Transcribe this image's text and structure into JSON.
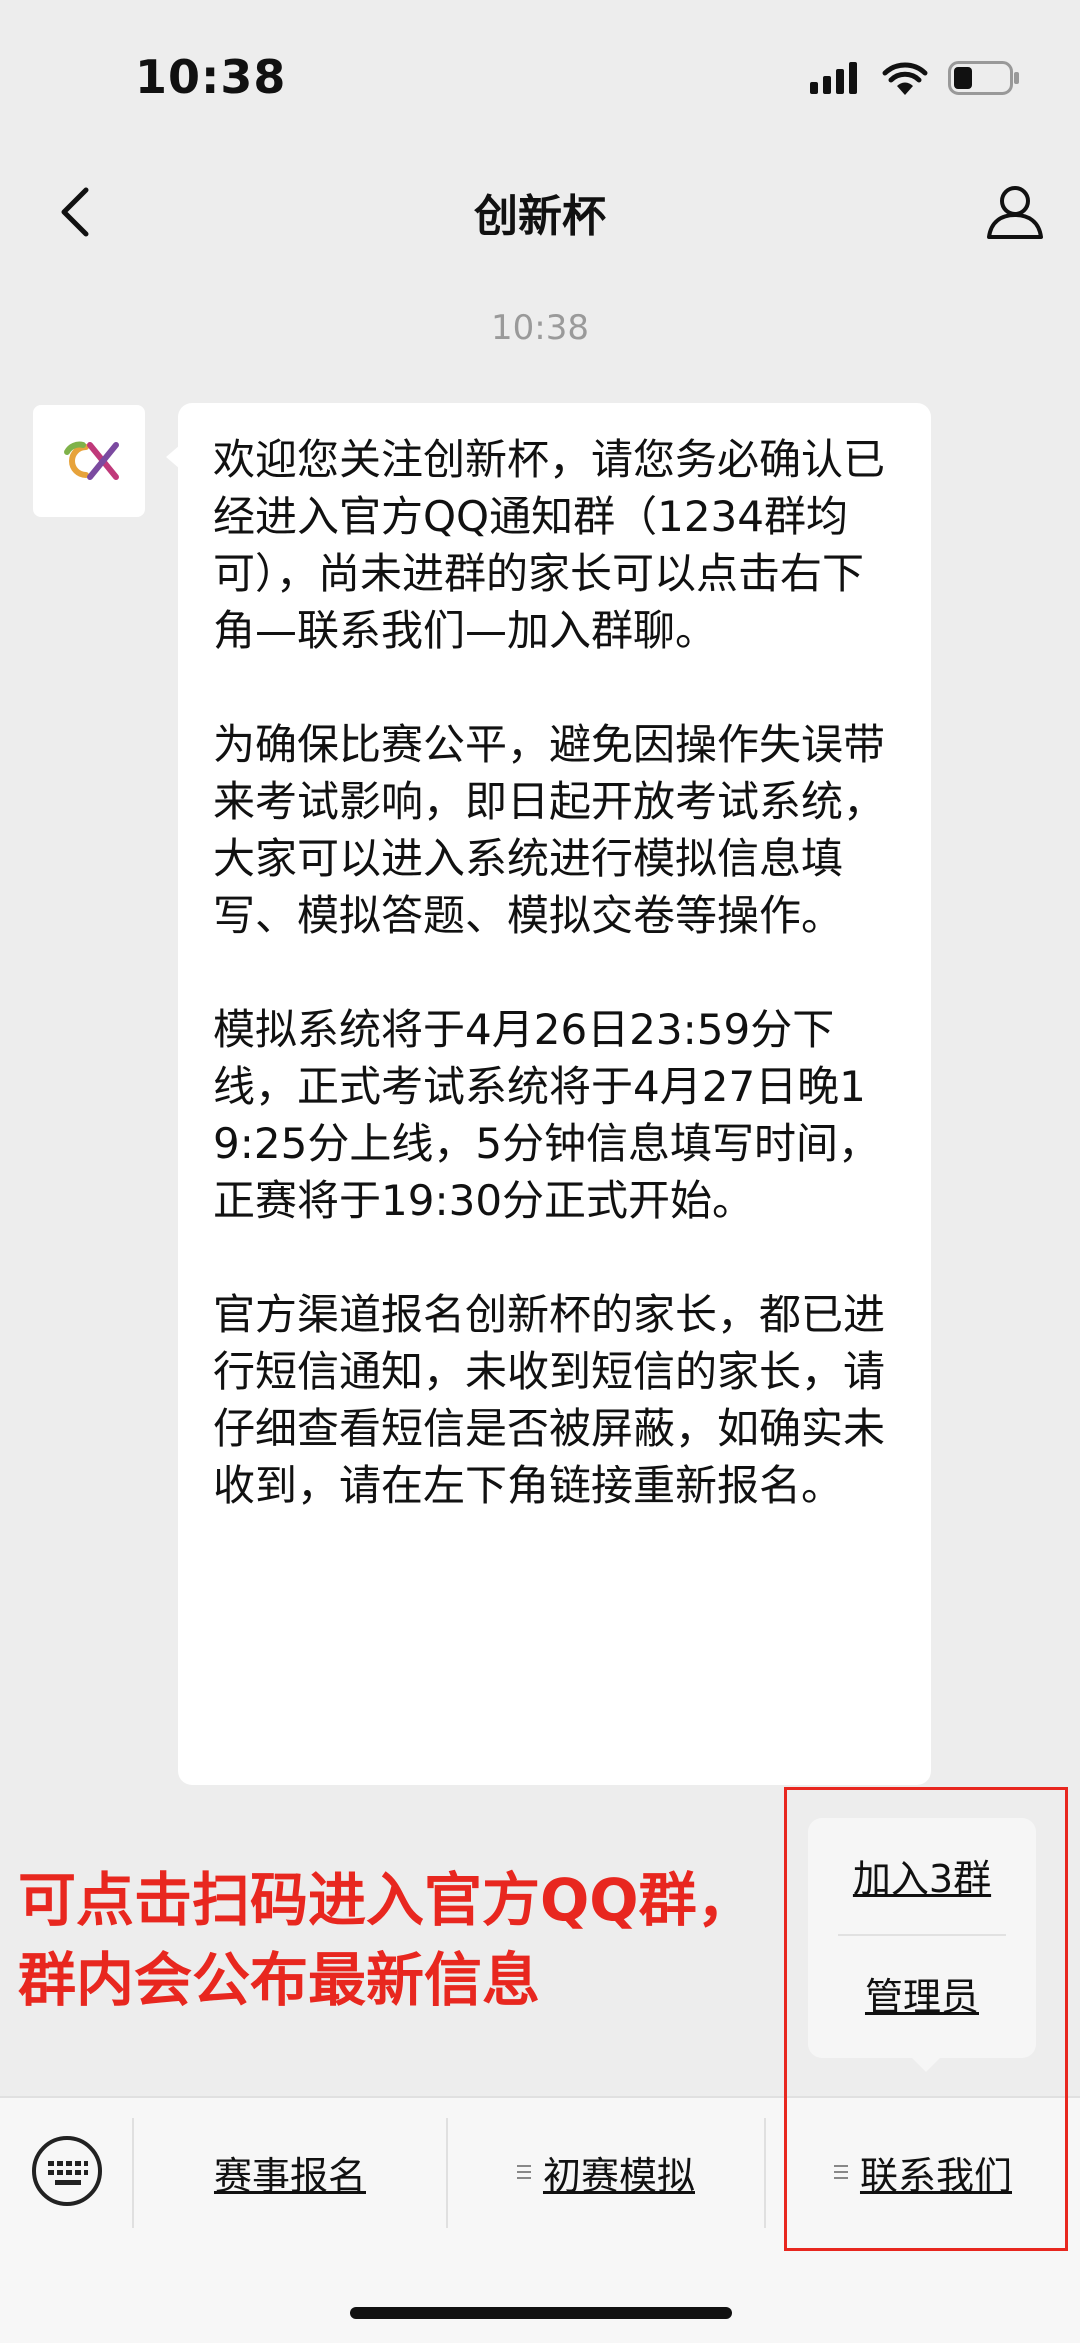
{
  "status_bar": {
    "time": "10:38",
    "icons": [
      "signal-icon",
      "wifi-icon",
      "battery-icon"
    ]
  },
  "nav": {
    "title": "创新杯",
    "back_icon": "chevron-left-icon",
    "profile_icon": "person-icon"
  },
  "chat": {
    "timestamp": "10:38",
    "avatar_text": "CX",
    "message_paragraphs": [
      "欢迎您关注创新杯，请您务必确认已经进入官方QQ通知群（1234群均可），尚未进群的家长可以点击右下角—联系我们—加入群聊。",
      "为确保比赛公平，避免因操作失误带来考试影响，即日起开放考试系统，大家可以进入系统进行模拟信息填写、模拟答题、模拟交卷等操作。",
      "模拟系统将于4月26日23:59分下线，正式考试系统将于4月27日晚19:25分上线，5分钟信息填写时间，正赛将于19:30分正式开始。",
      "官方渠道报名创新杯的家长，都已进行短信通知，未收到短信的家长，请仔细查看短信是否被屏蔽，如确实未收到，请在左下角链接重新报名。"
    ]
  },
  "annotation": {
    "text": "可点击扫码进入官方QQ群，群内会公布最新信息",
    "color": "#e8271f"
  },
  "popup_menu": {
    "items": [
      "加入3群",
      "管理员"
    ]
  },
  "bottom_menu": {
    "keyboard_icon": "keyboard-icon",
    "items": [
      {
        "label": "赛事报名",
        "has_submenu": false
      },
      {
        "label": "初赛模拟",
        "has_submenu": true
      },
      {
        "label": "联系我们",
        "has_submenu": true
      }
    ]
  }
}
